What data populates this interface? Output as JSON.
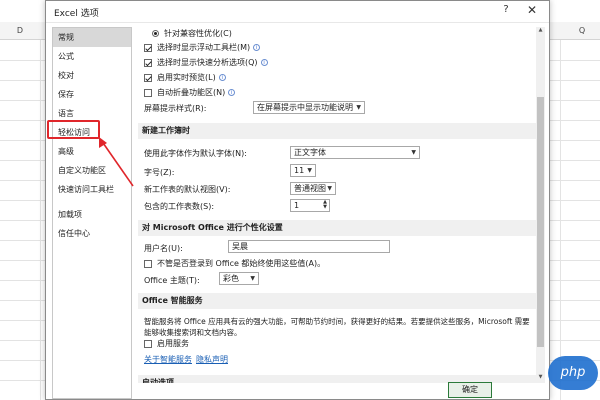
{
  "sheet": {
    "col_left": "D",
    "col_right": "Q"
  },
  "dialog": {
    "title": "Excel 选项",
    "help": "?",
    "close": "✕",
    "ok": "确定"
  },
  "nav": {
    "items": [
      "常规",
      "公式",
      "校对",
      "保存",
      "语言",
      "轻松访问",
      "高级",
      "自定义功能区",
      "快速访问工具栏",
      "加载项",
      "信任中心"
    ],
    "selected": "常规",
    "highlighted": "高级"
  },
  "general": {
    "opt_compat": "针对兼容性优化(C)",
    "opt_float_toolbar": "选择时显示浮动工具栏(M)",
    "opt_quick_analysis": "选择时显示快速分析选项(Q)",
    "opt_live_preview": "启用实时预览(L)",
    "opt_collapse_ribbon": "自动折叠功能区(N)",
    "tooltip_label": "屏幕提示样式(R):",
    "tooltip_value": "在屏幕提示中显示功能说明"
  },
  "new_wb": {
    "section": "新建工作簿时",
    "font_label": "使用此字体作为默认字体(N):",
    "font_value": "正文字体",
    "size_label": "字号(Z):",
    "size_value": "11",
    "view_label": "新工作表的默认视图(V):",
    "view_value": "普通视图",
    "sheets_label": "包含的工作表数(S):",
    "sheets_value": "1"
  },
  "personalize": {
    "section": "对 Microsoft Office 进行个性化设置",
    "user_label": "用户名(U):",
    "user_value": "吴晨",
    "always_use": "不管是否登录到 Office 都始终使用这些值(A)。",
    "theme_label": "Office 主题(T):",
    "theme_value": "彩色"
  },
  "smart": {
    "section": "Office 智能服务",
    "desc": "智能服务将 Office 应用具有云的强大功能，可帮助节约时间，获得更好的结果。若要提供这些服务，Microsoft 需要能够收集搜索词和文档内容。",
    "enable": "启用服务",
    "link_about": "关于智能服务",
    "link_privacy": "隐私声明"
  },
  "startup": {
    "section": "启动选项"
  },
  "watermark": "php"
}
